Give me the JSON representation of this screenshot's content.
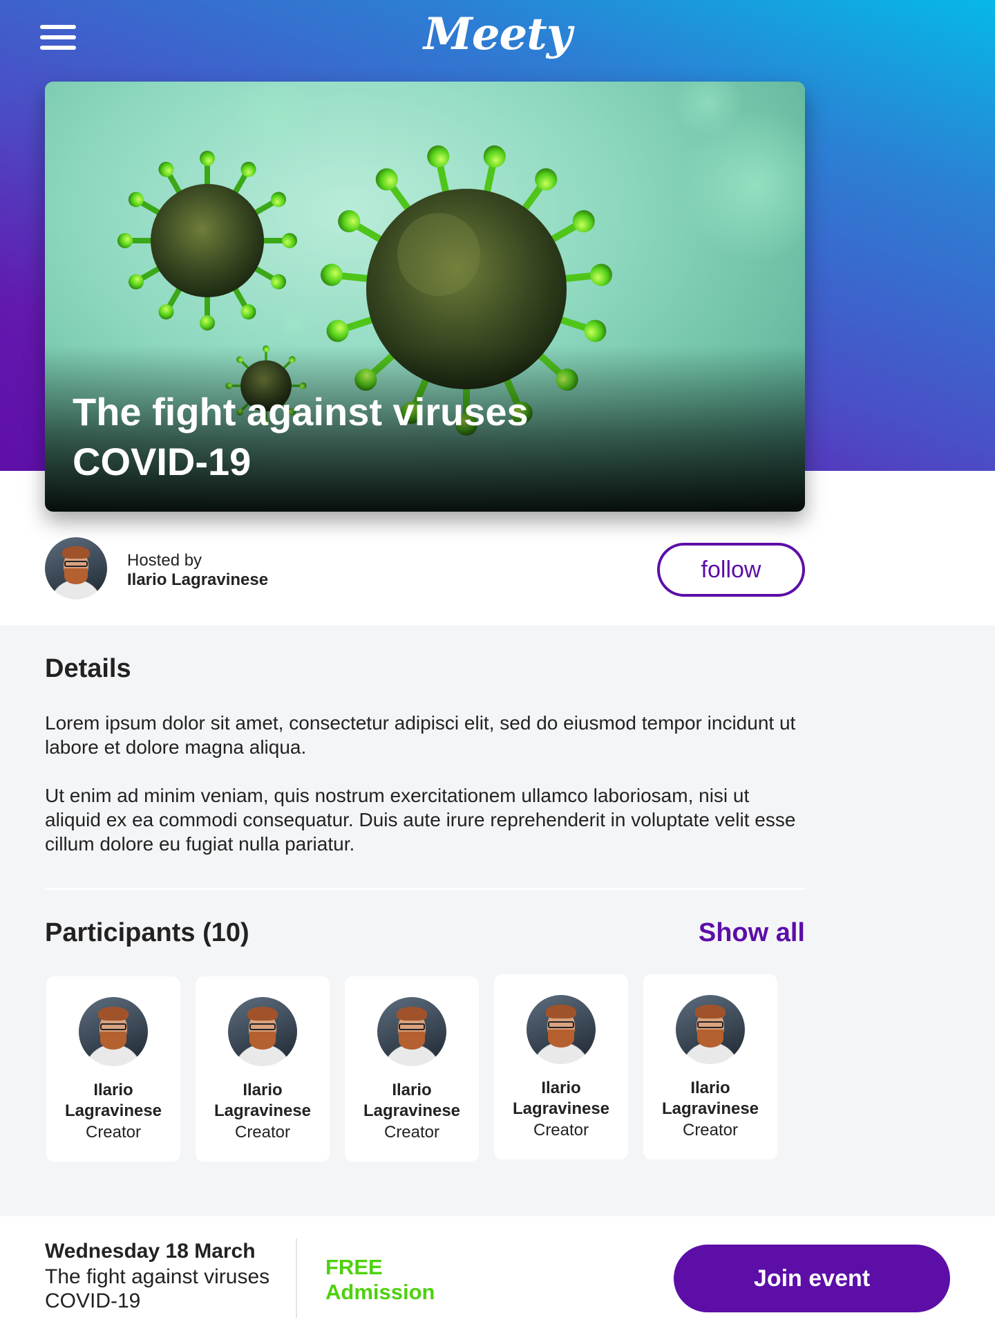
{
  "header": {
    "logo": "Meety",
    "menu_icon": "hamburger-menu-icon"
  },
  "hero": {
    "title_line1": "The fight against viruses",
    "title_line2": "COVID-19"
  },
  "host": {
    "label": "Hosted by",
    "name": "Ilario Lagravinese",
    "follow_label": "follow"
  },
  "details": {
    "title": "Details",
    "paragraph1": "Lorem ipsum dolor sit amet, consectetur adipisci elit, sed do eiusmod tempor incidunt ut labore et dolore magna aliqua.",
    "paragraph2": "Ut enim ad minim veniam, quis nostrum exercitationem ullamco laboriosam, nisi ut aliquid ex ea commodi consequatur. Duis aute irure reprehenderit in voluptate velit esse cillum dolore eu fugiat nulla pariatur."
  },
  "participants": {
    "title": "Participants (10)",
    "show_all_label": "Show all",
    "items": [
      {
        "first": "Ilario",
        "last": "Lagravinese",
        "role": "Creator"
      },
      {
        "first": "Ilario",
        "last": "Lagravinese",
        "role": "Creator"
      },
      {
        "first": "Ilario",
        "last": "Lagravinese",
        "role": "Creator"
      },
      {
        "first": "Ilario",
        "last": "Lagravinese",
        "role": "Creator"
      },
      {
        "first": "Ilario",
        "last": "Lagravinese",
        "role": "Creator"
      }
    ]
  },
  "footer": {
    "date": "Wednesday 18 March",
    "event_line1": "The fight against viruses",
    "event_line2": "COVID-19",
    "admission_line1": "FREE",
    "admission_line2": "Admission",
    "join_label": "Join event"
  },
  "colors": {
    "brand": "#5c0ea7",
    "accent_green": "#4ed10e",
    "header_gradient_start": "#06b9e6",
    "header_gradient_end": "#5e0fa8"
  }
}
